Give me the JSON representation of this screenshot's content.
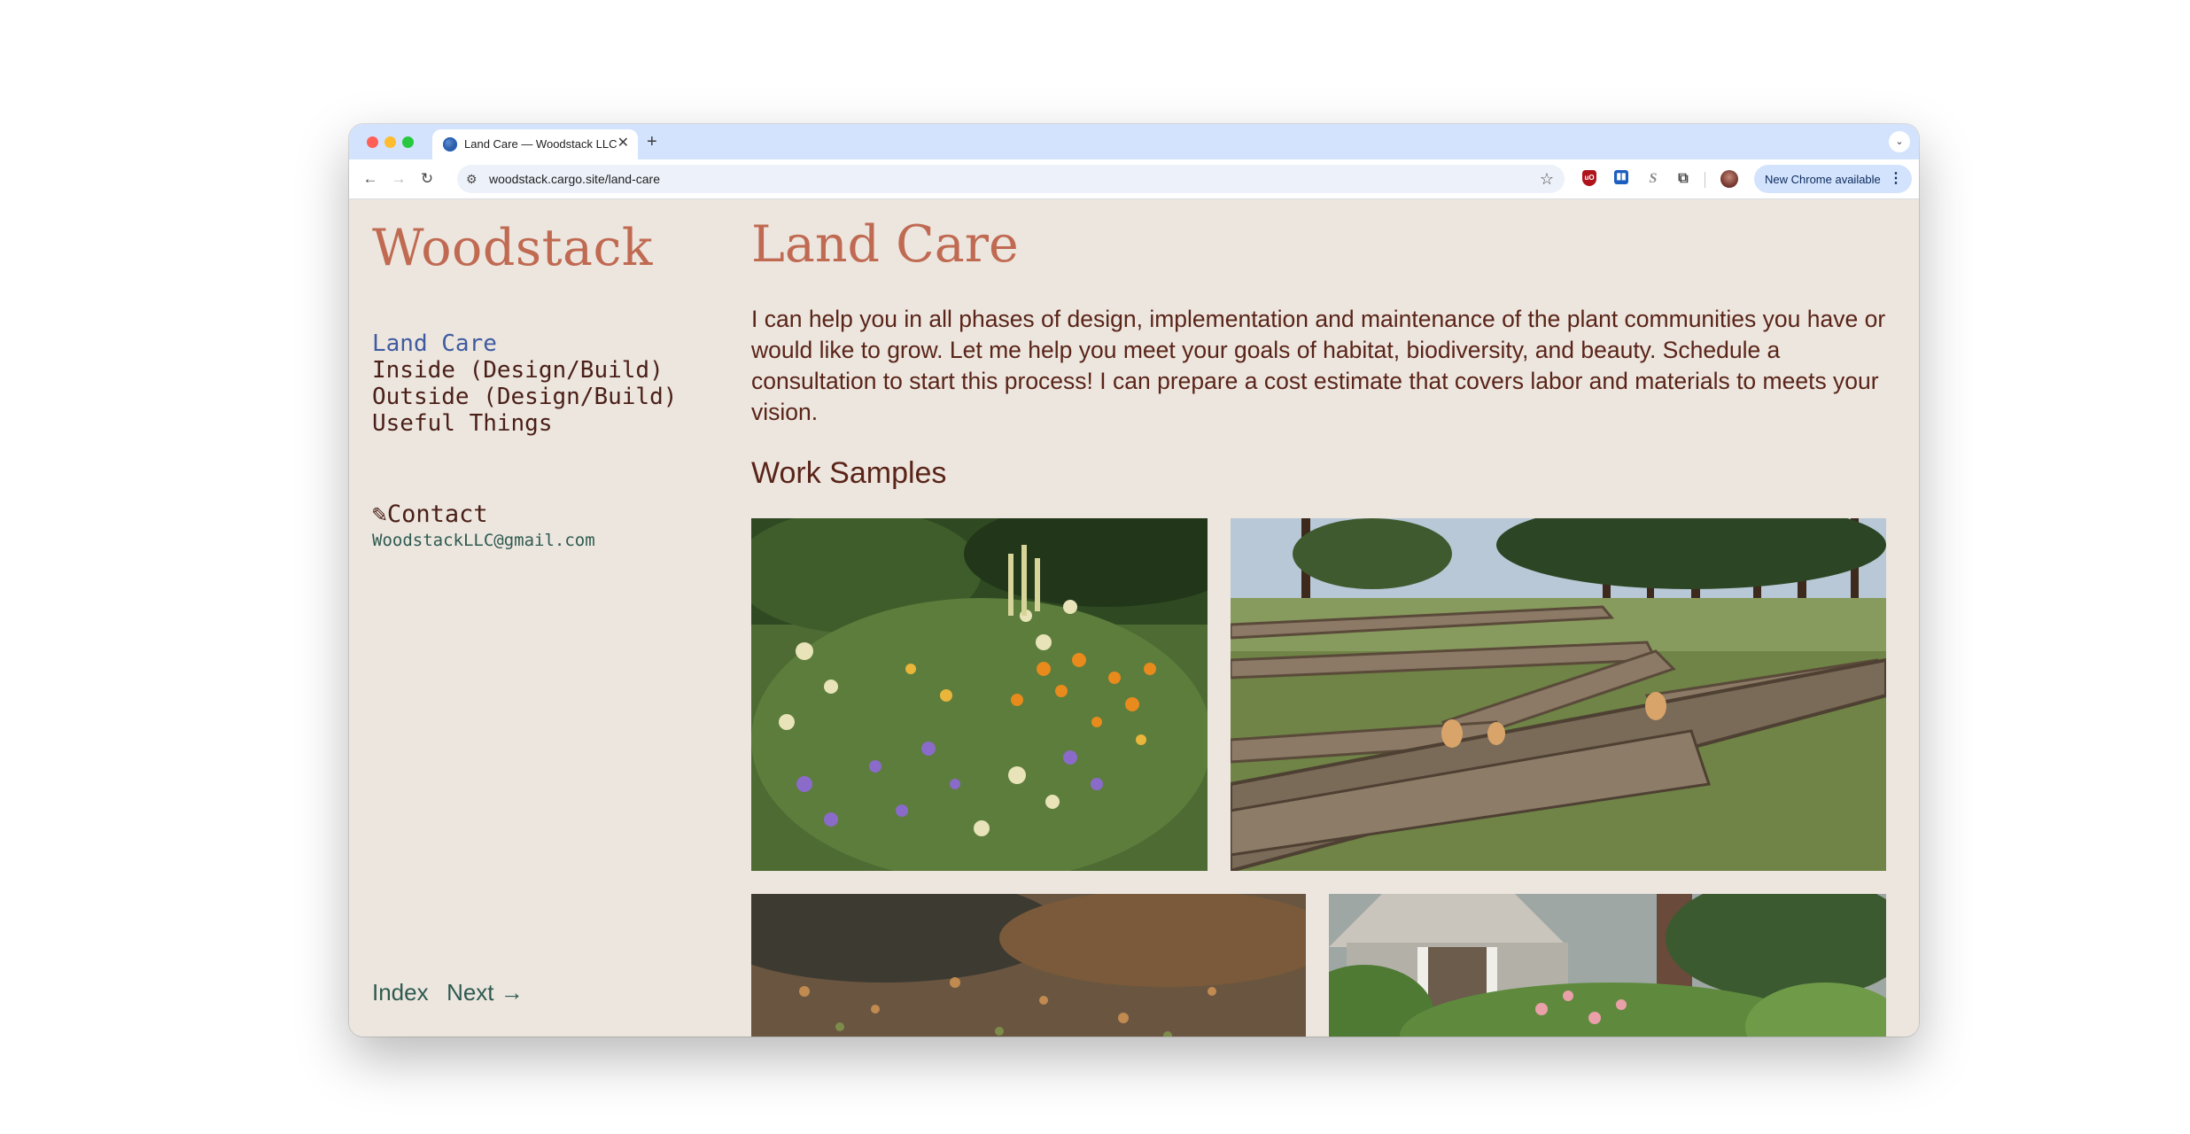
{
  "browser": {
    "tab_title": "Land Care — Woodstack LLC",
    "tab_close_glyph": "✕",
    "new_tab_glyph": "+",
    "url": "woodstack.cargo.site/land-care",
    "update_label": "New Chrome available",
    "icons": [
      "back-arrow-icon",
      "forward-arrow-icon",
      "reload-icon",
      "site-info-icon",
      "bookmark-star-icon",
      "ublock-extension-icon",
      "trello-extension-icon",
      "script-extension-icon",
      "extensions-puzzle-icon",
      "profile-avatar",
      "more-menu-icon"
    ]
  },
  "sidebar": {
    "site_title": "Woodstack",
    "nav": [
      {
        "label": "Land Care",
        "active": true
      },
      {
        "label": "Inside (Design/Build)",
        "active": false
      },
      {
        "label": "Outside (Design/Build)",
        "active": false
      },
      {
        "label": "Useful Things",
        "active": false
      }
    ],
    "contact_icon": "✎",
    "contact_label": "Contact",
    "contact_email": "WoodstackLLC@gmail.com",
    "footer": {
      "index_label": "Index",
      "next_label": "Next →"
    }
  },
  "content": {
    "title": "Land Care",
    "intro": "I can help you in all phases of design, implementation and maintenance of the plant communities you have or would like to grow.  Let me help you meet your goals of habitat, biodiversity, and beauty.  Schedule a consultation to start this process! I can prepare a cost estimate that covers labor and materials to meets your vision.",
    "section_heading": "Work Samples",
    "photos": [
      "wildflower-meadow-photo",
      "felled-logs-photo",
      "ground-closeup-photo",
      "house-garden-photo"
    ]
  },
  "colors": {
    "page_background": "#ece6df",
    "heading_terracotta": "#c06a52",
    "body_brown": "#5a2418",
    "active_link_blue": "#3f5ba0",
    "email_green": "#2e5a50"
  }
}
